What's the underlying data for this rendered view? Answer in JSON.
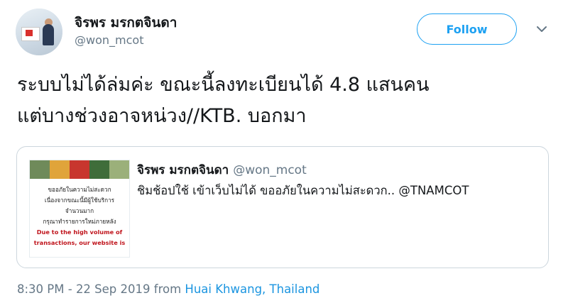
{
  "author": {
    "display_name": "จิรพร มรกตจินดา",
    "handle": "@won_mcot"
  },
  "follow_button": {
    "label": "Follow",
    "color": "#1da1f2"
  },
  "tweet": {
    "lines": [
      "ระบบไม่ได้ล่มค่ะ ขณะนี้ลงทะเบียนได้ 4.8 แสนคน",
      "แต่บางช่วงอาจหน่วง//KTB. บอกมา"
    ]
  },
  "quoted_tweet": {
    "display_name": "จิรพร มรกตจินดา",
    "handle": "@won_mcot",
    "text": "ชิมช้อปใช้ เข้าเว็บไม่ได้  ขออภัยในความไม่สะดวก.. @TNAMCOT",
    "image_text": {
      "thai_lines": [
        "ขออภัยในความไม่สะดวก",
        "เนื่องจากขณะนี้มีผู้ใช้บริการ",
        "จำนวนมาก",
        "กรุณาทำรายการใหม่ภายหลัง"
      ],
      "english_lines": [
        "Due to the high volume of",
        "transactions, our website is"
      ]
    }
  },
  "meta": {
    "time": "8:30 PM",
    "date": "22 Sep 2019",
    "from_label": "from",
    "location": "Huai Khwang, Thailand"
  }
}
